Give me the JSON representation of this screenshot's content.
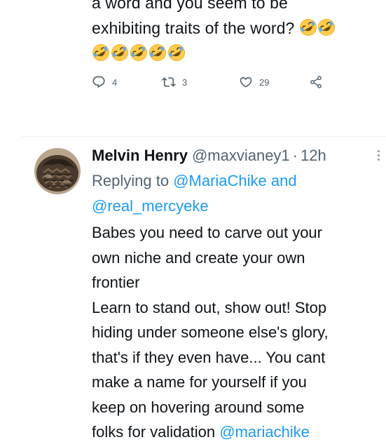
{
  "prev_tweet": {
    "line1": "a word and you seem to be",
    "line2": "exhibiting traits of the word?",
    "emoji_line1_count": 2,
    "emoji_line2_count": 5,
    "emoji_name": "rolling-on-the-floor-laughing",
    "actions": {
      "replies": "4",
      "retweets": "3",
      "likes": "29"
    }
  },
  "reply": {
    "name": "Melvin Henry",
    "handle": "@maxvianey1",
    "separator": "·",
    "time": "12h",
    "replying_prefix": "Replying to",
    "replying_user1": "@MariaChike",
    "replying_and": "and",
    "replying_user2": "@real_mercyeke",
    "body_lines": [
      "Babes you need to carve out your",
      "own niche and create your own",
      "frontier",
      "Learn to stand out, show out! Stop",
      "hiding under someone else's glory,",
      "that's if  they even have... You cant",
      "make a name for yourself if you",
      "keep on hovering around some",
      "folks for validation"
    ],
    "trailing_mention": "@mariachike"
  },
  "colors": {
    "text": "#0f1419",
    "secondary": "#536471",
    "link": "#1d9bf0",
    "divider": "#eff3f4"
  }
}
